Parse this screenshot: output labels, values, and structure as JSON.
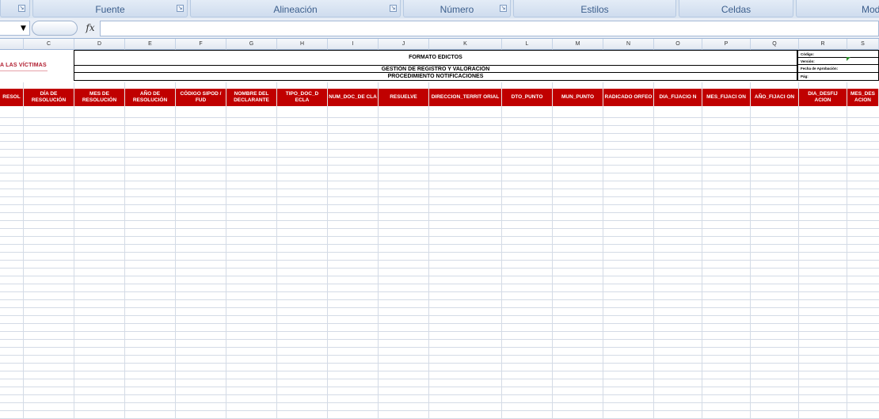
{
  "ribbon": {
    "groups": [
      {
        "label": ""
      },
      {
        "label": "Fuente"
      },
      {
        "label": "Alineación"
      },
      {
        "label": "Número"
      },
      {
        "label": "Estilos"
      },
      {
        "label": "Celdas"
      },
      {
        "label": "Mod"
      }
    ]
  },
  "formula_bar": {
    "fx_label": "fx",
    "dropdown": "▼"
  },
  "columns": [
    "C",
    "D",
    "E",
    "F",
    "G",
    "H",
    "I",
    "J",
    "K",
    "L",
    "M",
    "N",
    "O",
    "P",
    "Q",
    "R",
    "S"
  ],
  "sheet": {
    "logo_text": "A LAS VÍCTIMAS",
    "title_1": "FORMATO EDICTOS",
    "title_2": "GESTIÓN DE REGISTRO Y VALORACIÓN",
    "title_3": "PROCEDIMIENTO NOTIFICACIONES",
    "info": [
      "Código:",
      "Versión:",
      "Fecha de Aprobación:",
      "Pág:"
    ]
  },
  "table_headers": [
    "RESOL",
    "DÍA DE RESOLUCIÓN",
    "MES DE RESOLUCIÓN",
    "AÑO DE RESOLUCIÓN",
    "CÓDIGO SIPOD / FUD",
    "NOMBRE DEL DECLARANTE",
    "TIPO_DOC_D ECLA",
    "NUM_DOC_DE CLA",
    "RESUELVE",
    "DIRECCION_TERRIT ORIAL",
    "DTO_PUNTO",
    "MUN_PUNTO",
    "RADICADO ORFEO",
    "DIA_FIJACIO N",
    "MES_FIJACI ON",
    "AÑO_FIJACI ON",
    "DIA_DESFIJ ACION",
    "MES_DES ACION"
  ]
}
